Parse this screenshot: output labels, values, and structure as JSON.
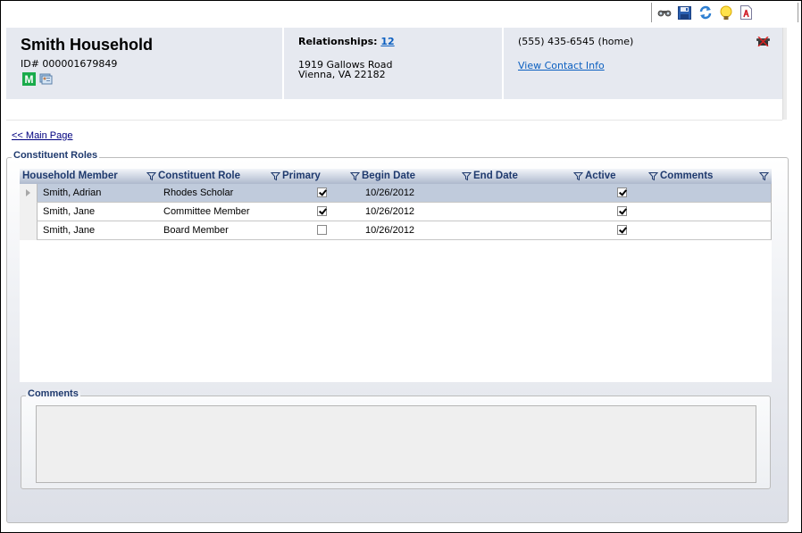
{
  "toolbar": {
    "icons": [
      "binoculars-icon",
      "save-icon",
      "refresh-icon",
      "lightbulb-icon",
      "pdf-report-icon"
    ]
  },
  "header": {
    "title": "Smith Household",
    "id_line": "ID# 000001679849",
    "badge_letter": "M",
    "relationships_label": "Relationships:",
    "relationships_count": "12",
    "address_line1": "1919 Gallows Road",
    "address_line2": "Vienna, VA 22182",
    "phone": "(555) 435-6545 (home)",
    "view_contact_label": "View Contact Info"
  },
  "nav": {
    "main_page_label": "<< Main Page"
  },
  "constituent_roles": {
    "legend": "Constituent Roles",
    "columns": [
      {
        "label": "Household Member",
        "filter": false
      },
      {
        "label": "Constituent Role",
        "filter": true
      },
      {
        "label": "Primary",
        "filter": true
      },
      {
        "label": "Begin Date",
        "filter": true
      },
      {
        "label": "End Date",
        "filter": true
      },
      {
        "label": "Active",
        "filter": true
      },
      {
        "label": "Comments",
        "filter": true
      }
    ],
    "rows": [
      {
        "member": "Smith, Adrian",
        "role": "Rhodes Scholar",
        "primary": true,
        "begin_date": "10/26/2012",
        "end_date": "",
        "active": true,
        "comments": "",
        "selected": true
      },
      {
        "member": "Smith, Jane",
        "role": "Committee Member",
        "primary": true,
        "begin_date": "10/26/2012",
        "end_date": "",
        "active": true,
        "comments": "",
        "selected": false
      },
      {
        "member": "Smith, Jane",
        "role": "Board Member",
        "primary": false,
        "begin_date": "10/26/2012",
        "end_date": "",
        "active": true,
        "comments": "",
        "selected": false
      }
    ]
  },
  "comments": {
    "legend": "Comments",
    "value": ""
  },
  "colors": {
    "header_bg": "#e6e9f0",
    "link": "#0b5fc0",
    "grid_header_text": "#1f3a6e",
    "selected_row": "#c0cbdc",
    "badge_green": "#1aab4b"
  }
}
